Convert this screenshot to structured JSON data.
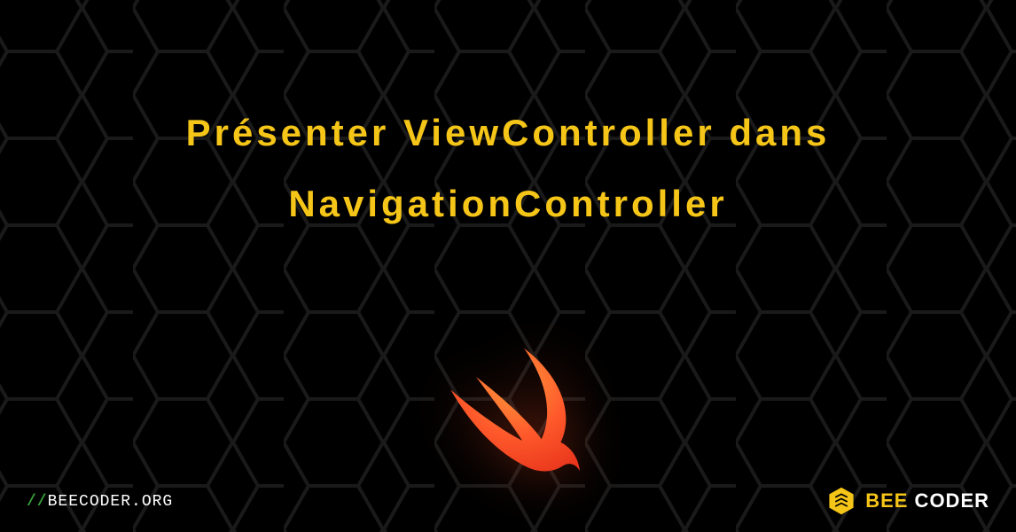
{
  "title_line1": "Présenter ViewController dans",
  "title_line2": "NavigationController",
  "url_text": "BEECODER.ORG",
  "brand_bee": "BEE",
  "brand_coder": " CODER"
}
